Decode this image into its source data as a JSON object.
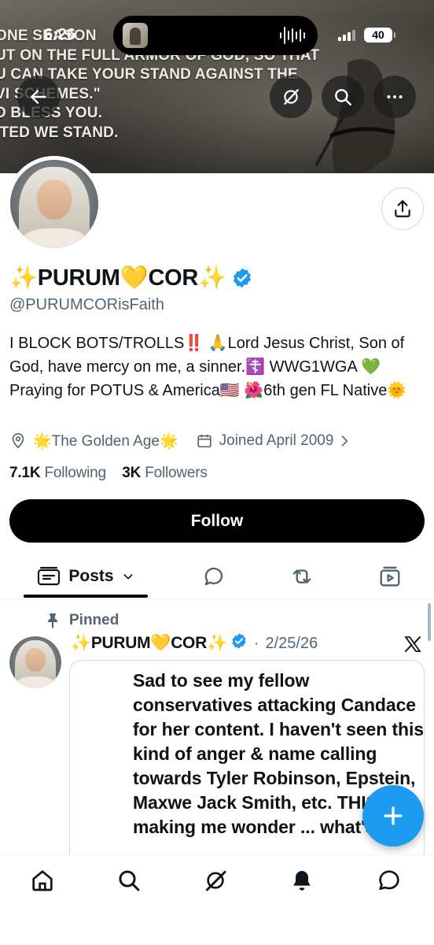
{
  "status_bar": {
    "time": "6:26",
    "battery": "40"
  },
  "banner": {
    "lines": [
      "ONE SEASON",
      "UT ON THE FULL ARMOR OF GOD, SO THAT",
      "U CAN TAKE YOUR STAND AGAINST THE",
      "VI   SCHEMES.\"",
      "D BLESS YOU.",
      "ITED WE STAND."
    ]
  },
  "header_icons": {
    "back": "arrow-left-icon",
    "grok": "grok-icon",
    "search": "search-icon",
    "more": "more-icon"
  },
  "profile": {
    "display_name_left": "✨PURUM💛COR✨",
    "verified_color": "#1d9bf0",
    "handle": "@PURUMCORisFaith",
    "bio": "I BLOCK BOTS/TROLLS‼️ 🙏Lord Jesus Christ, Son of God, have mercy on me, a sinner.☦️ WWG1WGA 💚Praying for POTUS & America🇺🇸 🌺6th gen FL Native🌞",
    "location": "🌟The Golden Age🌟",
    "joined": "Joined April 2009",
    "following_count": "7.1K",
    "following_label": "Following",
    "followers_count": "3K",
    "followers_label": "Followers",
    "follow_button": "Follow"
  },
  "tabs": {
    "posts_label": "Posts",
    "icons": [
      "posts-icon",
      "chevron-down-icon",
      "reply-icon",
      "repost-icon",
      "media-icon"
    ]
  },
  "post": {
    "pinned_label": "Pinned",
    "author_name": "✨PURUM💛COR✨",
    "date": "2/25/26",
    "separator": "·",
    "media_text": "Sad to see my fellow conservatives attacking Candace for her content. I haven't seen this kind of anger & name calling towards Tyler Robinson, Epstein, Maxwe Jack Smith, etc. THIS is re making me wonder ... what's"
  },
  "colors": {
    "accent": "#1d9bf0",
    "text_primary": "#0f1419",
    "text_secondary": "#536471",
    "follow_bg": "#000000"
  },
  "bottom_nav": [
    "home-icon",
    "search-icon",
    "grok-icon",
    "notifications-icon",
    "messages-icon"
  ]
}
